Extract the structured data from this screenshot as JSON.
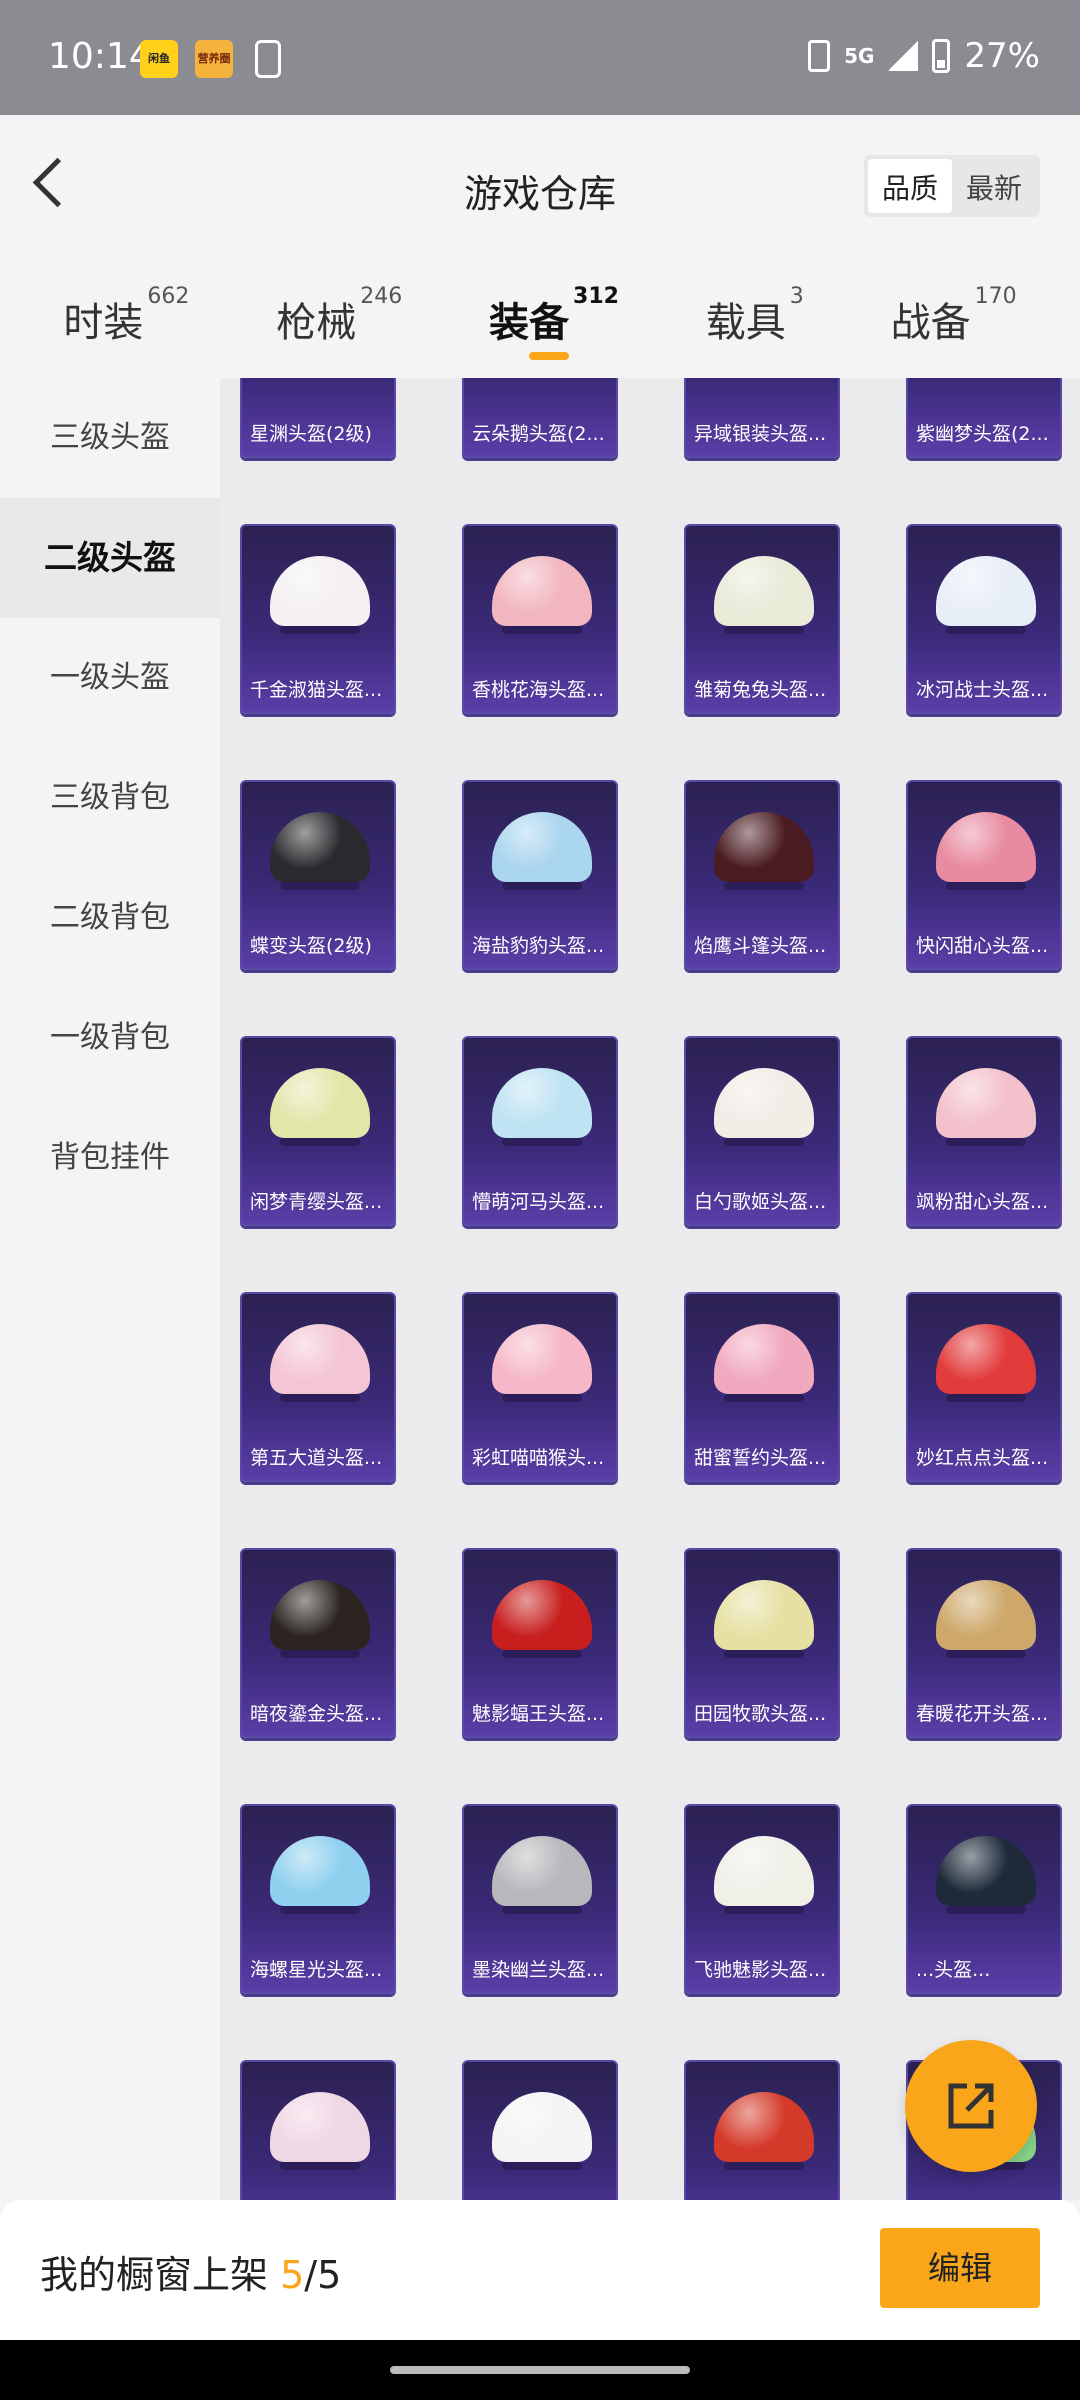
{
  "status_bar": {
    "time": "10:14",
    "network": "5G",
    "battery": "27%",
    "app_icons": [
      "闲鱼",
      "营养圈"
    ]
  },
  "header": {
    "title": "游戏仓库",
    "sort_options": [
      "品质",
      "最新"
    ],
    "sort_selected": "品质"
  },
  "tabs": [
    {
      "label": "时装",
      "count": "662"
    },
    {
      "label": "枪械",
      "count": "246"
    },
    {
      "label": "装备",
      "count": "312"
    },
    {
      "label": "载具",
      "count": "3"
    },
    {
      "label": "战备",
      "count": "170"
    }
  ],
  "active_tab": "装备",
  "sidebar": {
    "items": [
      "三级头盔",
      "二级头盔",
      "一级头盔",
      "三级背包",
      "二级背包",
      "一级背包",
      "背包挂件"
    ],
    "active": "二级头盔"
  },
  "items": [
    {
      "name": "星渊头盔(2级)",
      "color": "#8b86b8"
    },
    {
      "name": "云朵鹅头盔(2...",
      "color": "#9fd3ee"
    },
    {
      "name": "异域银装头盔...",
      "color": "#4a6b78"
    },
    {
      "name": "紫幽梦头盔(2...",
      "color": "#7a5fc8"
    },
    {
      "name": "千金淑猫头盔...",
      "color": "#f4f0f4"
    },
    {
      "name": "香桃花海头盔...",
      "color": "#f2b6c0"
    },
    {
      "name": "雏菊兔兔头盔...",
      "color": "#e9ead8"
    },
    {
      "name": "冰河战士头盔...",
      "color": "#e8eef8"
    },
    {
      "name": "蝶变头盔(2级)",
      "color": "#2a2a2e"
    },
    {
      "name": "海盐豹豹头盔...",
      "color": "#a9d5ee"
    },
    {
      "name": "焰鹰斗篷头盔...",
      "color": "#4a1c22"
    },
    {
      "name": "快闪甜心头盔...",
      "color": "#e88aa0"
    },
    {
      "name": "闲梦青缨头盔...",
      "color": "#e3e6a9"
    },
    {
      "name": "懵萌河马头盔...",
      "color": "#bfe3f2"
    },
    {
      "name": "白勺歌姬头盔...",
      "color": "#f1ece6"
    },
    {
      "name": "飒粉甜心头盔...",
      "color": "#f3c1cb"
    },
    {
      "name": "第五大道头盔...",
      "color": "#f4c6d4"
    },
    {
      "name": "彩虹喵喵猴头...",
      "color": "#f6b8c8"
    },
    {
      "name": "甜蜜誓约头盔...",
      "color": "#f1a9bf"
    },
    {
      "name": "妙红点点头盔...",
      "color": "#e23b3b"
    },
    {
      "name": "暗夜鎏金头盔...",
      "color": "#2b2420"
    },
    {
      "name": "魅影蝠王头盔...",
      "color": "#c81e1e"
    },
    {
      "name": "田园牧歌头盔...",
      "color": "#e6e1a3"
    },
    {
      "name": "春暖花开头盔...",
      "color": "#cda86a"
    },
    {
      "name": "海螺星光头盔...",
      "color": "#8fd0ef"
    },
    {
      "name": "墨染幽兰头盔...",
      "color": "#b6b8bb"
    },
    {
      "name": "飞驰魅影头盔...",
      "color": "#f0efe8"
    },
    {
      "name": "...头盔...",
      "color": "#1e2a3a"
    },
    {
      "name": "",
      "color": "#f0d7e4"
    },
    {
      "name": "",
      "color": "#f4f4f4"
    },
    {
      "name": "",
      "color": "#d43a2a"
    },
    {
      "name": "",
      "color": "#88d488"
    }
  ],
  "bottom": {
    "showcase_label": "我的橱窗上架",
    "count_current": "5",
    "count_sep_total": "/5",
    "edit_label": "编辑"
  }
}
